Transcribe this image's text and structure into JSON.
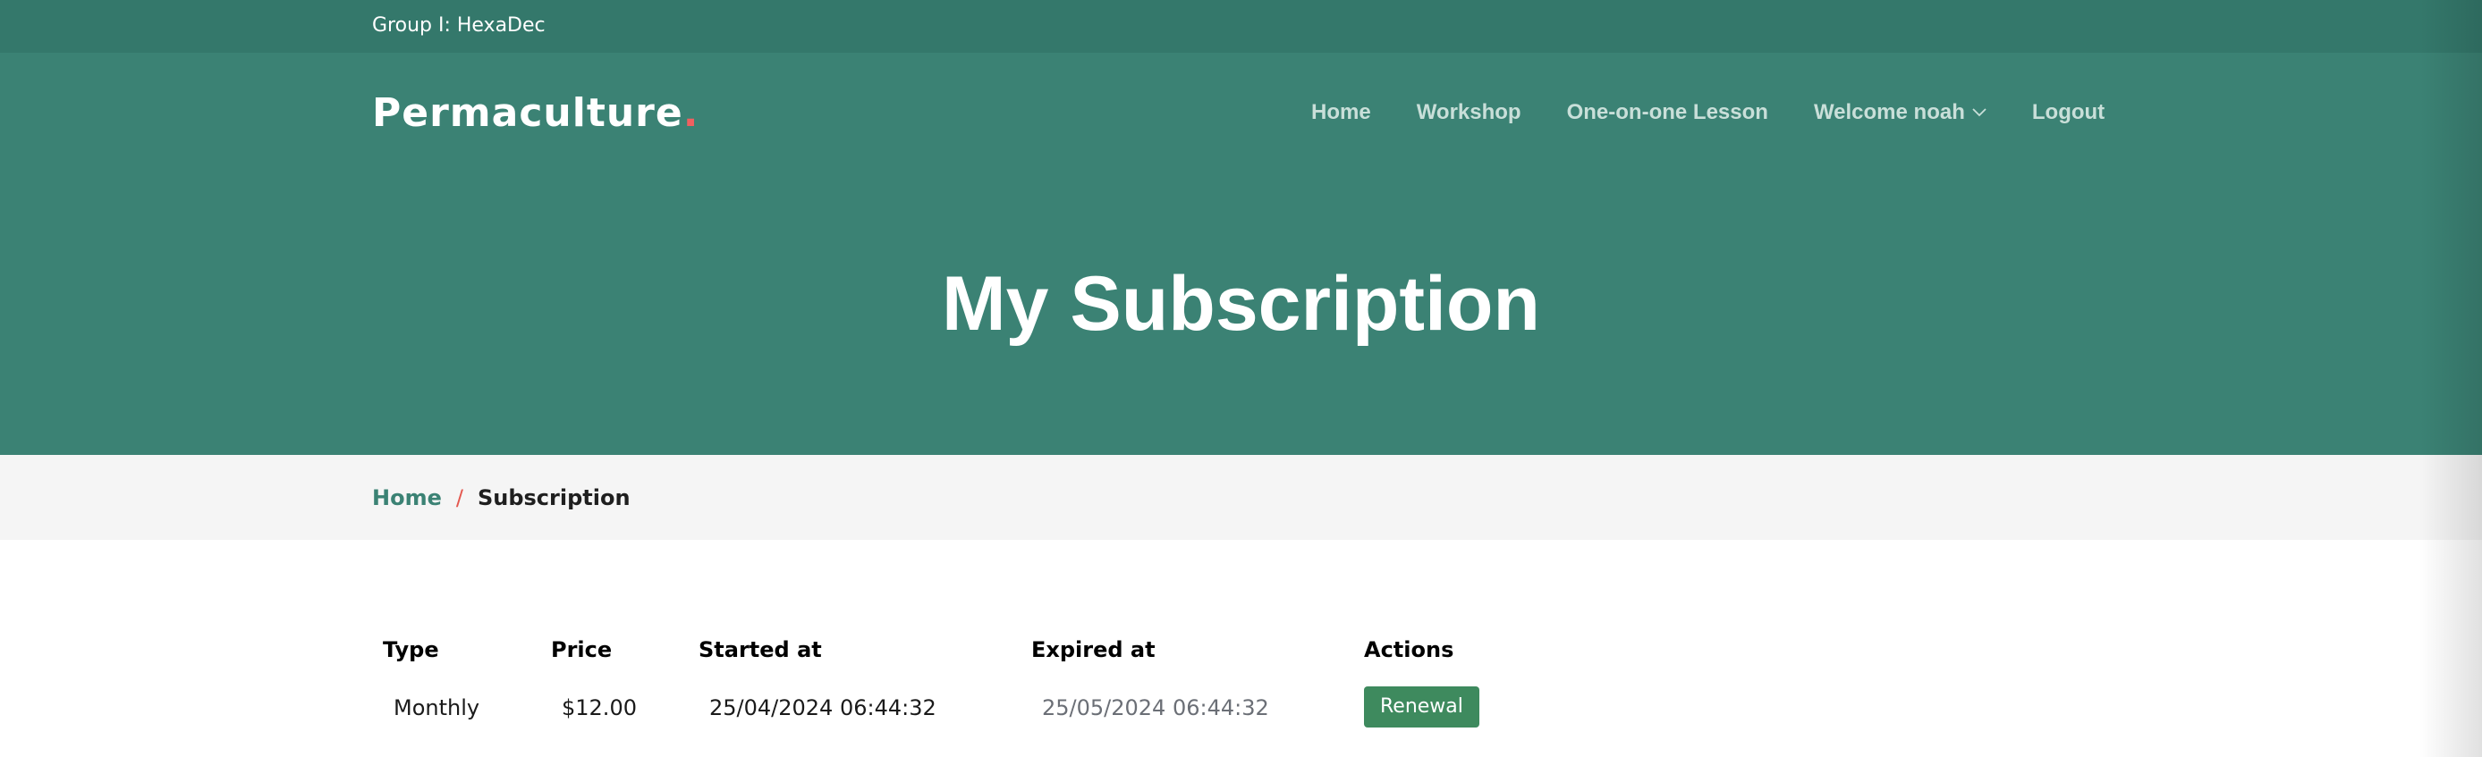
{
  "topbar": {
    "group_label": "Group I: HexaDec"
  },
  "brand": {
    "name": "Permaculture",
    "dot": "."
  },
  "nav": {
    "items": [
      {
        "label": "Home"
      },
      {
        "label": "Workshop"
      },
      {
        "label": "One-on-one Lesson"
      },
      {
        "label": "Welcome noah"
      },
      {
        "label": "Logout"
      }
    ]
  },
  "hero": {
    "title": "My Subscription"
  },
  "breadcrumb": {
    "home": "Home",
    "separator": "/",
    "current": "Subscription"
  },
  "table": {
    "headers": [
      "Type",
      "Price",
      "Started at",
      "Expired at",
      "Actions"
    ],
    "rows": [
      {
        "type": "Monthly",
        "price": "$12.00",
        "started_at": "25/04/2024 06:44:32",
        "expired_at": "25/05/2024 06:44:32",
        "action_label": "Renewal"
      }
    ]
  },
  "colors": {
    "topbar": "#34786b",
    "hero": "#3b8274",
    "accent_dot": "#f06060",
    "breadcrumb_bg": "#f5f5f5",
    "button": "#3e8a5e"
  },
  "icons": {
    "dropdown": "chevron-down-icon"
  }
}
